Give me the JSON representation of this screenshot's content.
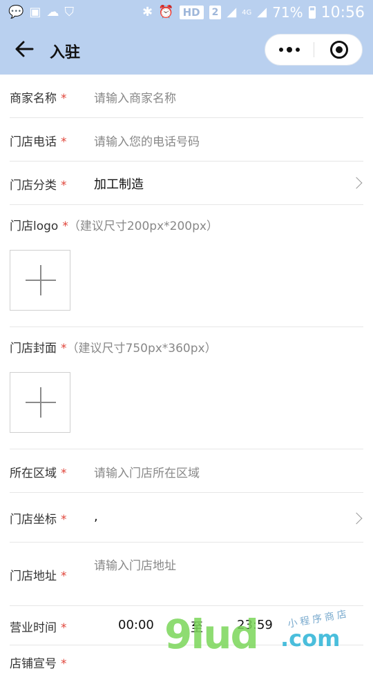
{
  "status_bar": {
    "battery_percent": "71%",
    "time": "10:56",
    "hd_label": "HD",
    "sim_label": "2",
    "network_label": "4G",
    "left_icons": [
      "wechat-icon",
      "gallery-icon",
      "app-icon",
      "shield-check-icon"
    ],
    "right_icons": [
      "bluetooth-icon",
      "alarm-icon",
      "signal-icon",
      "signal-icon-2",
      "battery-icon"
    ]
  },
  "navbar": {
    "title": "入驻",
    "back_icon": "arrow-left-icon",
    "more_icon": "more-dots-icon",
    "close_icon": "target-circle-icon"
  },
  "form": {
    "merchant_name": {
      "label": "商家名称",
      "required": "*",
      "placeholder": "请输入商家名称"
    },
    "store_phone": {
      "label": "门店电话",
      "required": "*",
      "placeholder": "请输入您的电话号码"
    },
    "store_category": {
      "label": "门店分类",
      "required": "*",
      "value": "加工制造"
    },
    "store_logo": {
      "label": "门店logo",
      "required": "*",
      "hint": "（建议尺寸200px*200px）"
    },
    "store_cover": {
      "label": "门店封面",
      "required": "*",
      "hint": "（建议尺寸750px*360px）"
    },
    "region": {
      "label": "所在区域",
      "required": "*",
      "placeholder": "请输入门店所在区域"
    },
    "coordinates": {
      "label": "门店坐标",
      "required": "*",
      "value": ","
    },
    "address": {
      "label": "门店地址",
      "required": "*",
      "placeholder": "请输入门店地址"
    },
    "business_hours": {
      "label": "营业时间",
      "required": "*",
      "start": "00:00",
      "separator": "至",
      "end": "23:59"
    },
    "next_row": {
      "label": "店铺宣号",
      "required": "*"
    }
  },
  "watermark": {
    "big": "9lud",
    "com": ".com",
    "small": "小程序商店"
  },
  "colors": {
    "header": "#b9d0ef",
    "required": "#e0453a",
    "placeholder": "#888888"
  }
}
